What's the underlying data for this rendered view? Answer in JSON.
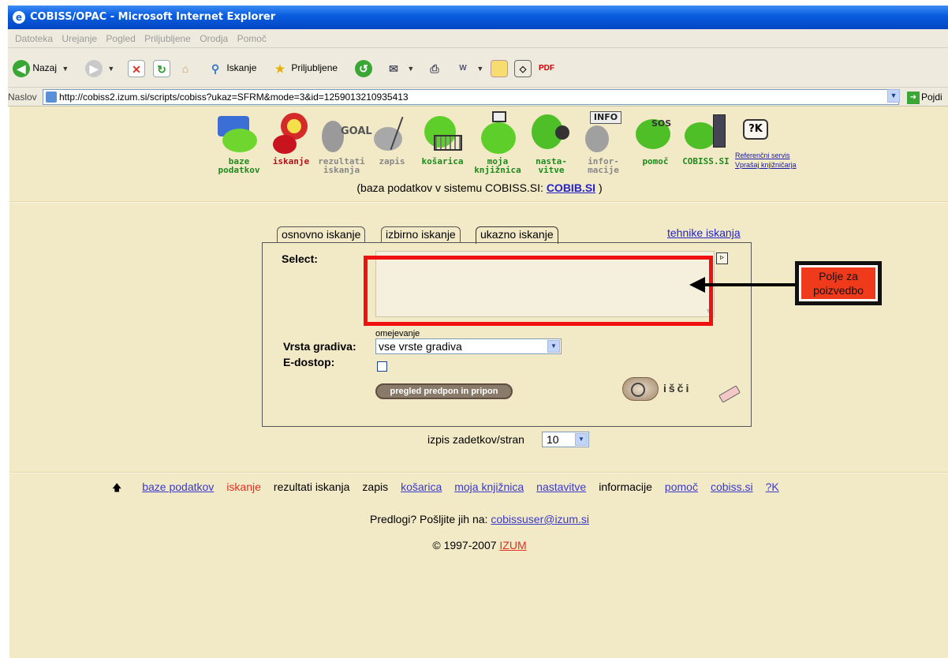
{
  "window": {
    "title": "COBISS/OPAC - Microsoft Internet Explorer"
  },
  "menu": [
    "Datoteka",
    "Urejanje",
    "Pogled",
    "Priljubljene",
    "Orodja",
    "Pomoč"
  ],
  "toolbar": {
    "back": "Nazaj",
    "search": "Iskanje",
    "favorites": "Priljubljene"
  },
  "address": {
    "label": "Naslov",
    "url": "http://cobiss2.izum.si/scripts/cobiss?ukaz=SFRM&mode=3&id=1259013210935413",
    "go": "Pojdi"
  },
  "nav_icons": [
    {
      "line1": "baze",
      "line2": "podatkov",
      "icon": "data-icon"
    },
    {
      "line1": "",
      "line2": "iskanje",
      "icon": "magnifier-icon"
    },
    {
      "line1": "rezultati",
      "line2": "iskanja",
      "icon": "goal-icon"
    },
    {
      "line1": "",
      "line2": "zapis",
      "icon": "record-icon"
    },
    {
      "line1": "",
      "line2": "košarica",
      "icon": "cart-icon"
    },
    {
      "line1": "moja",
      "line2": "knjižnica",
      "icon": "library-icon"
    },
    {
      "line1": "nasta-",
      "line2": "vitve",
      "icon": "settings-icon"
    },
    {
      "line1": "infor-",
      "line2": "macije",
      "icon": "info-icon"
    },
    {
      "line1": "",
      "line2": "pomoč",
      "icon": "sos-icon"
    },
    {
      "line1": "",
      "line2": "COBISS.SI",
      "icon": "exit-icon"
    }
  ],
  "ref_service": {
    "badge": "?K",
    "line1": "Referenčni servis",
    "line2": "Vprašaj knjižničarja"
  },
  "db_line": {
    "prefix": "(baza podatkov v sistemu COBISS.SI:",
    "db": "COBIB.SI",
    "suffix": ")"
  },
  "tabs": [
    "osnovno iskanje",
    "izbirno iskanje",
    "ukazno iskanje"
  ],
  "tech_link": "tehnike iskanja",
  "form": {
    "select_label": "Select:",
    "query_value": "",
    "restrict_label": "omejevanje",
    "material_label": "Vrsta gradiva:",
    "material_value": "vse vrste gradiva",
    "eaccess_label": "E-dostop:",
    "prefix_button": "pregled predpon in pripon",
    "search_button": "išči"
  },
  "annotation": {
    "text": "Polje za poizvedbo"
  },
  "results_per_page": {
    "label": "izpis zadetkov/stran",
    "value": "10"
  },
  "bottom_nav": [
    {
      "label": "baze podatkov",
      "style": "lnk"
    },
    {
      "label": "iskanje",
      "style": "cur"
    },
    {
      "label": "rezultati iskanja",
      "style": "plain"
    },
    {
      "label": "zapis",
      "style": "plain"
    },
    {
      "label": "košarica",
      "style": "lnk"
    },
    {
      "label": "moja knjižnica",
      "style": "lnk"
    },
    {
      "label": "nastavitve",
      "style": "lnk"
    },
    {
      "label": "informacije",
      "style": "plain"
    },
    {
      "label": "pomoč",
      "style": "lnk"
    },
    {
      "label": "cobiss.si",
      "style": "lnk"
    },
    {
      "label": "?K",
      "style": "lnk"
    }
  ],
  "feedback": {
    "text": "Predlogi? Pošljite jih na:",
    "email": "cobissuser@izum.si"
  },
  "copyright": {
    "text": "© 1997-2007",
    "org": "IZUM"
  },
  "colors": {
    "page_bg": "#f2e9c6",
    "highlight": "#f01010",
    "link": "#3a3acc",
    "current": "#e03020"
  }
}
